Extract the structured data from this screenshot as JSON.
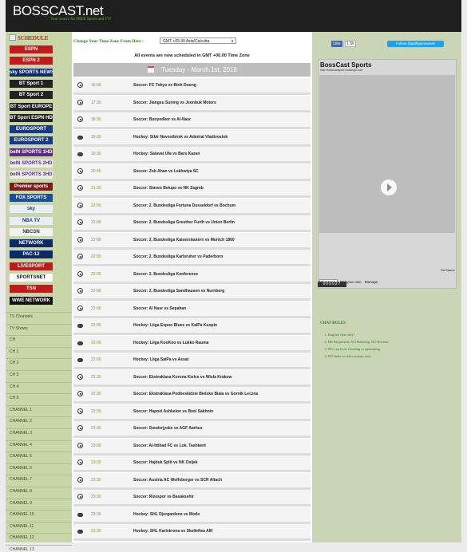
{
  "header": {
    "brand": "BOSSCAST.net",
    "tagline": "Your source for FREE Sports and TV!"
  },
  "sidebar": {
    "schedule_label": "SCHEDULE",
    "logos": [
      {
        "name": "espn-logo",
        "label": "ESPN",
        "bg": "#c4191a",
        "fg": "#ffffff"
      },
      {
        "name": "espn2-logo",
        "label": "ESPN 2",
        "bg": "#c4191a",
        "fg": "#ffffff"
      },
      {
        "name": "sky-sports-news-logo",
        "label": "sky SPORTS NEWS",
        "bg": "#0b2a6b",
        "fg": "#ffffff"
      },
      {
        "name": "bt-sport-1-logo",
        "label": "BT Sport 1",
        "bg": "#222222",
        "fg": "#ffffff"
      },
      {
        "name": "bt-sport-2-logo",
        "label": "BT Sport 2",
        "bg": "#222222",
        "fg": "#ffffff"
      },
      {
        "name": "bt-sport-europe-logo",
        "label": "BT Sport EUROPE",
        "bg": "#222222",
        "fg": "#ffffff"
      },
      {
        "name": "bt-sport-espn-hd-logo",
        "label": "BT Sport ESPN HD",
        "bg": "#222222",
        "fg": "#ffffff"
      },
      {
        "name": "eurosport-logo",
        "label": "EUROSPORT",
        "bg": "#143a8a",
        "fg": "#ffffff"
      },
      {
        "name": "eurosport-2-logo",
        "label": "EUROSPORT 2",
        "bg": "#143a8a",
        "fg": "#ffffff"
      },
      {
        "name": "bein-sports-1-logo",
        "label": "beIN SPORTS 1HD",
        "bg": "#5a2a86",
        "fg": "#ffffff"
      },
      {
        "name": "bein-sports-2-logo",
        "label": "beIN SPORTS 2HD",
        "bg": "#eeeeee",
        "fg": "#5a2a86"
      },
      {
        "name": "bein-sports-3-logo",
        "label": "beIN SPORTS 3HD",
        "bg": "#eeeeee",
        "fg": "#5a2a86"
      },
      {
        "name": "premier-sports-logo",
        "label": "Premier sports",
        "bg": "#7a1d1d",
        "fg": "#ffffff"
      },
      {
        "name": "fox-sports-logo",
        "label": "FOX SPORTS",
        "bg": "#1a4fa0",
        "fg": "#ffffff"
      },
      {
        "name": "sky-logo",
        "label": "sky",
        "bg": "#e8eef8",
        "fg": "#1a3a8a"
      },
      {
        "name": "nba-tv-logo",
        "label": "NBA TV",
        "bg": "#e8eef8",
        "fg": "#1a3a8a"
      },
      {
        "name": "nbcsn-logo",
        "label": "NBCSN",
        "bg": "#f2f2f2",
        "fg": "#333333"
      },
      {
        "name": "nfl-network-logo",
        "label": "NETWORK",
        "bg": "#0b2a6b",
        "fg": "#ffffff"
      },
      {
        "name": "pac12-logo",
        "label": "PAC-12",
        "bg": "#0b2a6b",
        "fg": "#ffffff"
      },
      {
        "name": "nhl-livesport-logo",
        "label": "LIVESPORT",
        "bg": "#c4191a",
        "fg": "#ffffff"
      },
      {
        "name": "sportsnet-logo",
        "label": "SPORTSNET",
        "bg": "#ffffff",
        "fg": "#111111"
      },
      {
        "name": "tsn-logo",
        "label": "TSN",
        "bg": "#c4191a",
        "fg": "#ffffff"
      },
      {
        "name": "wwe-network-logo",
        "label": "WWE NETWORK",
        "bg": "#111111",
        "fg": "#ffffff"
      }
    ],
    "links": [
      "TV Channels",
      "TV Shows",
      "CH",
      "CH 1",
      "CH 2",
      "CH 3",
      "CH 4",
      "CH 5",
      "CHANNEL 1",
      "CHANNEL 2",
      "CHANNEL 3",
      "CHANNEL 4",
      "CHANNEL 5",
      "CHANNEL 6",
      "CHANNEL 7",
      "CHANNEL 8",
      "CHANNEL 9",
      "CHANNEL 10",
      "CHANNEL 11",
      "CHANNEL 12",
      "CHANNEL 13"
    ]
  },
  "main": {
    "tz_label": "Change Your Time Zone From Here :",
    "tz_value": "GMT +05:30 Asia/Calcutta",
    "notice": "All events are now scheduled in GMT +00.00 Time Zone",
    "date": "Tuesday - March 1st, 2016",
    "events": [
      {
        "time": "16:00",
        "title": "Soccer: FC Tokyo vs Binh Duong",
        "sport": "soccer"
      },
      {
        "time": "17:30",
        "title": "Soccer: Jiangsu Suning vs Jeonbuk Motors",
        "sport": "soccer"
      },
      {
        "time": "18:30",
        "title": "Soccer: Bunyodkor vs Al-Nasr",
        "sport": "soccer"
      },
      {
        "time": "19:00",
        "title": "Hockey: Sibir Novosibirsk vs Admiral Vladivostok",
        "sport": "hockey"
      },
      {
        "time": "19:30",
        "title": "Hockey: Salavat Ufa vs Bars Kazan",
        "sport": "hockey"
      },
      {
        "time": "20:45",
        "title": "Soccer: Zob Ahan vs Lekhwiya SC",
        "sport": "soccer"
      },
      {
        "time": "21:30",
        "title": "Soccer: Slaven Belupo vs NK Zagreb",
        "sport": "soccer"
      },
      {
        "time": "22:00",
        "title": "Soccer: 2. Bundesliga Fortuna Dusseldorf vs Bochum",
        "sport": "soccer"
      },
      {
        "time": "22:00",
        "title": "Soccer: 2. Bundesliga Greuther Furth vs Union Berlin",
        "sport": "soccer"
      },
      {
        "time": "22:00",
        "title": "Soccer: 2. Bundesliga Kaiserslautern vs Munich 1860",
        "sport": "soccer"
      },
      {
        "time": "22:00",
        "title": "Soccer: 2. Bundesliga Karlsruher vs Paderborn",
        "sport": "soccer"
      },
      {
        "time": "22:00",
        "title": "Soccer: 2. Bundesliga Konference",
        "sport": "soccer"
      },
      {
        "time": "22:00",
        "title": "Soccer: 2. Bundesliga Sandhausen vs Nurnberg",
        "sport": "soccer"
      },
      {
        "time": "22:00",
        "title": "Soccer: Al Nasr vs Sepahan",
        "sport": "soccer"
      },
      {
        "time": "22:00",
        "title": "Hockey: Liiga Espoo Blues vs KalPa Kuopio",
        "sport": "hockey"
      },
      {
        "time": "22:00",
        "title": "Hockey: Liiga KooKoo vs Lukko Rauma",
        "sport": "hockey"
      },
      {
        "time": "22:00",
        "title": "Hockey: Liiga SaiPa vs Assat",
        "sport": "hockey"
      },
      {
        "time": "22:30",
        "title": "Soccer: Ekstraklasa Korona Kielce vs Wisla Krakow",
        "sport": "soccer"
      },
      {
        "time": "22:30",
        "title": "Soccer: Ekstraklasa Podbeskidzie Bielsko Biala vs Gornik Leczna",
        "sport": "soccer"
      },
      {
        "time": "22:30",
        "title": "Soccer: Hapoel Ashkelon vs Bnei Sakhnin",
        "sport": "soccer"
      },
      {
        "time": "22:30",
        "title": "Soccer: Sonderjyske vs AGF Aarhus",
        "sport": "soccer"
      },
      {
        "time": "23:00",
        "title": "Soccer: Al-Ittihad FC vs Lok. Tashkent",
        "sport": "soccer"
      },
      {
        "time": "23:30",
        "title": "Soccer: Hajduk Split vs NK Osijek",
        "sport": "soccer"
      },
      {
        "time": "23:30",
        "title": "Soccer: Austria AC Wolfsberger vs SCR Altach",
        "sport": "soccer"
      },
      {
        "time": "23:30",
        "title": "Soccer: Rizespor vs Basaksehir",
        "sport": "soccer"
      },
      {
        "time": "23:30",
        "title": "Hockey: SHL Djurgardens vs Modo",
        "sport": "hockey"
      },
      {
        "time": "23:30",
        "title": "Hockey: SHL Karlskrona vs Skelleftea AIK",
        "sport": "hockey"
      }
    ]
  },
  "right": {
    "like_label": "Like",
    "like_count": "1.5k",
    "twitter_label": "Follow @gdiftypo1tweek",
    "chat_title": "BossCast Sports",
    "chat_url": "http://bosscastsport.chatango.com",
    "set_name": "Set Name",
    "get_own": "Get your own",
    "manage": "Manage",
    "counter": "000027",
    "rules_title": "CHAT RULES",
    "rules": [
      "English chat only!",
      "BE Respectful, NO Bullying, NO Racism",
      "NO cap lock, flooding or spamming",
      "NO links to other stream sites"
    ]
  }
}
